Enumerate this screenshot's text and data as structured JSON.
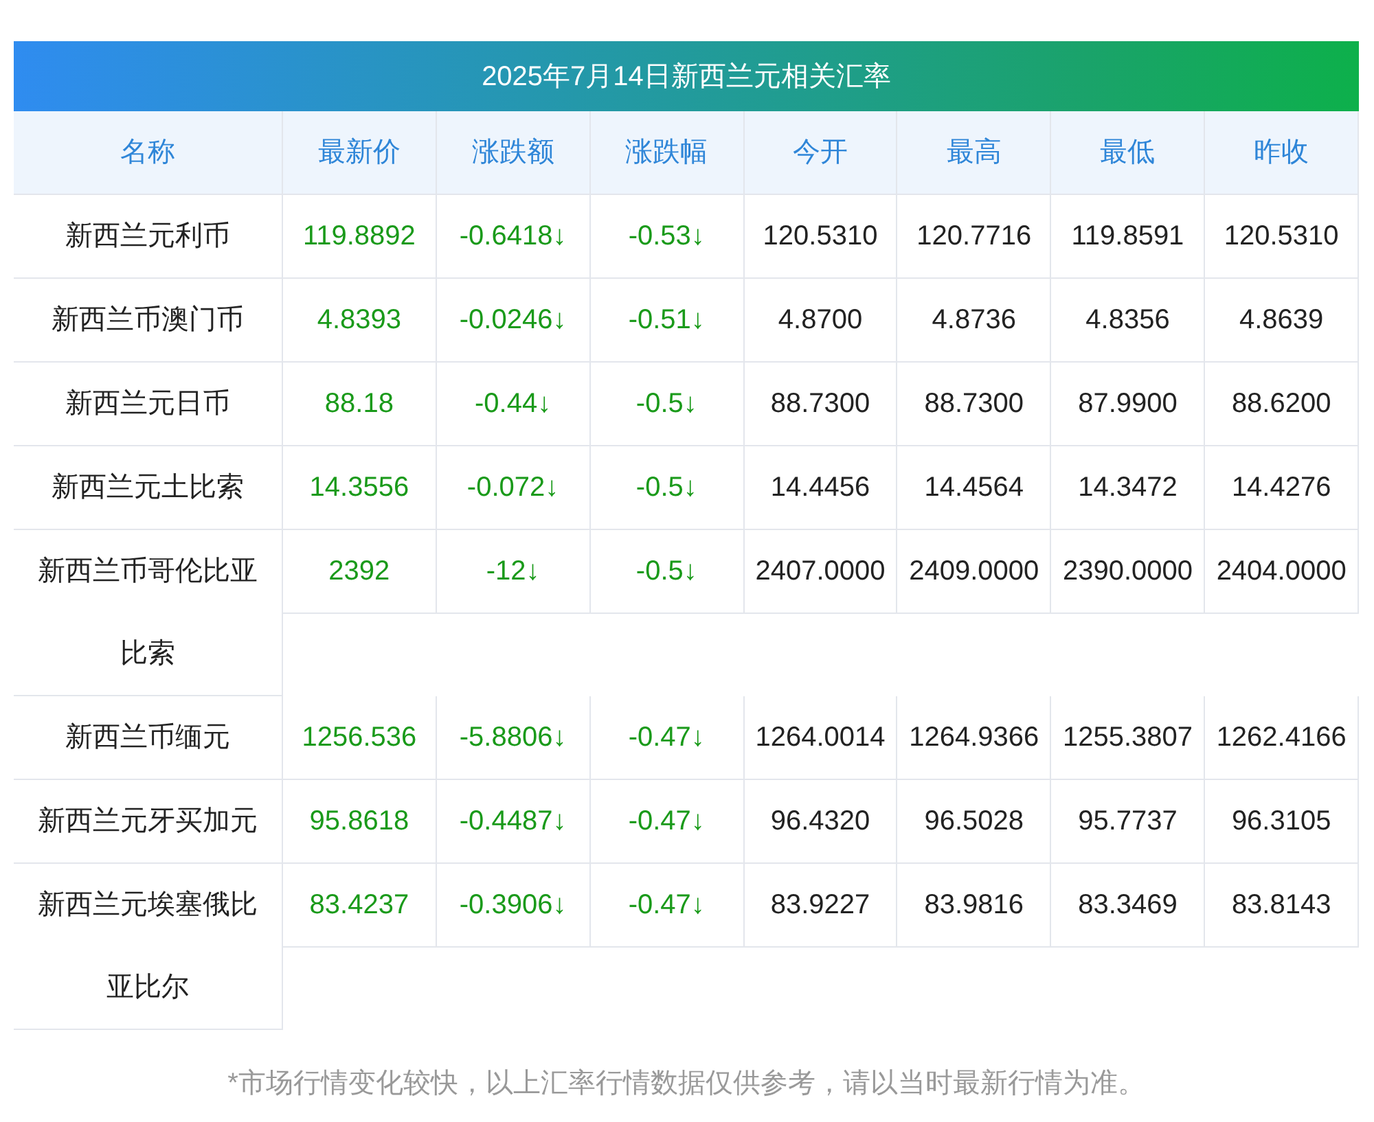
{
  "title": "2025年7月14日新西兰元相关汇率",
  "columns": [
    "名称",
    "最新价",
    "涨跌额",
    "涨跌幅",
    "今开",
    "最高",
    "最低",
    "昨收"
  ],
  "rows": [
    {
      "name": "新西兰元利币",
      "latest": "119.8892",
      "change": "-0.6418↓",
      "change_pct": "-0.53↓",
      "falling": true,
      "open": "120.5310",
      "high": "120.7716",
      "low": "119.8591",
      "prev_close": "120.5310"
    },
    {
      "name": "新西兰币澳门币",
      "latest": "4.8393",
      "change": "-0.0246↓",
      "change_pct": "-0.51↓",
      "falling": true,
      "open": "4.8700",
      "high": "4.8736",
      "low": "4.8356",
      "prev_close": "4.8639"
    },
    {
      "name": "新西兰元日币",
      "latest": "88.18",
      "change": "-0.44↓",
      "change_pct": "-0.5↓",
      "falling": true,
      "open": "88.7300",
      "high": "88.7300",
      "low": "87.9900",
      "prev_close": "88.6200"
    },
    {
      "name": "新西兰元土比索",
      "latest": "14.3556",
      "change": "-0.072↓",
      "change_pct": "-0.5↓",
      "falling": true,
      "open": "14.4456",
      "high": "14.4564",
      "low": "14.3472",
      "prev_close": "14.4276"
    },
    {
      "name": "新西兰币哥伦比亚比索",
      "latest": "2392",
      "change": "-12↓",
      "change_pct": "-0.5↓",
      "falling": true,
      "open": "2407.0000",
      "high": "2409.0000",
      "low": "2390.0000",
      "prev_close": "2404.0000"
    },
    {
      "name": "新西兰币缅元",
      "latest": "1256.536",
      "change": "-5.8806↓",
      "change_pct": "-0.47↓",
      "falling": true,
      "open": "1264.0014",
      "high": "1264.9366",
      "low": "1255.3807",
      "prev_close": "1262.4166"
    },
    {
      "name": "新西兰元牙买加元",
      "latest": "95.8618",
      "change": "-0.4487↓",
      "change_pct": "-0.47↓",
      "falling": true,
      "open": "96.4320",
      "high": "96.5028",
      "low": "95.7737",
      "prev_close": "96.3105"
    },
    {
      "name": "新西兰元埃塞俄比亚比尔",
      "latest": "83.4237",
      "change": "-0.3906↓",
      "change_pct": "-0.47↓",
      "falling": true,
      "open": "83.9227",
      "high": "83.9816",
      "low": "83.3469",
      "prev_close": "83.8143"
    }
  ],
  "footnote": "*市场行情变化较快，以上汇率行情数据仅供参考，请以当时最新行情为准。"
}
